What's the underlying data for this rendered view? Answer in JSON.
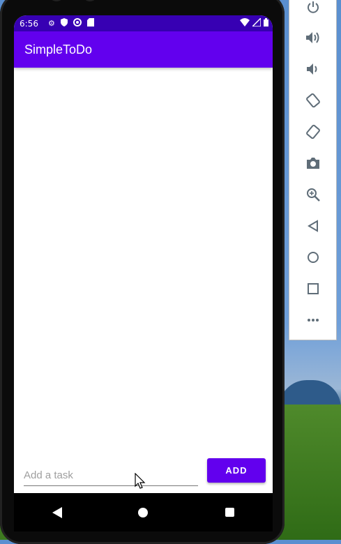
{
  "status_bar": {
    "time": "6:56",
    "left_icons": [
      "settings-icon",
      "shield-icon",
      "vpn-icon",
      "sd-card-icon"
    ],
    "right_icons": [
      "wifi-icon",
      "signal-icon",
      "battery-icon"
    ]
  },
  "app_bar": {
    "title": "SimpleToDo"
  },
  "input": {
    "placeholder": "Add a task",
    "value": ""
  },
  "add_button": {
    "label": "ADD"
  },
  "navigation": [
    "back-icon",
    "home-icon",
    "recents-icon"
  ],
  "emulator_toolbar": [
    "power-icon",
    "volume-up-icon",
    "volume-down-icon",
    "rotate-left-icon",
    "rotate-right-icon",
    "camera-icon",
    "zoom-icon",
    "back-icon",
    "home-icon",
    "overview-icon",
    "more-icon"
  ],
  "colors": {
    "status_bar": "#3700b3",
    "app_bar": "#6200ee",
    "button": "#6200ee"
  }
}
